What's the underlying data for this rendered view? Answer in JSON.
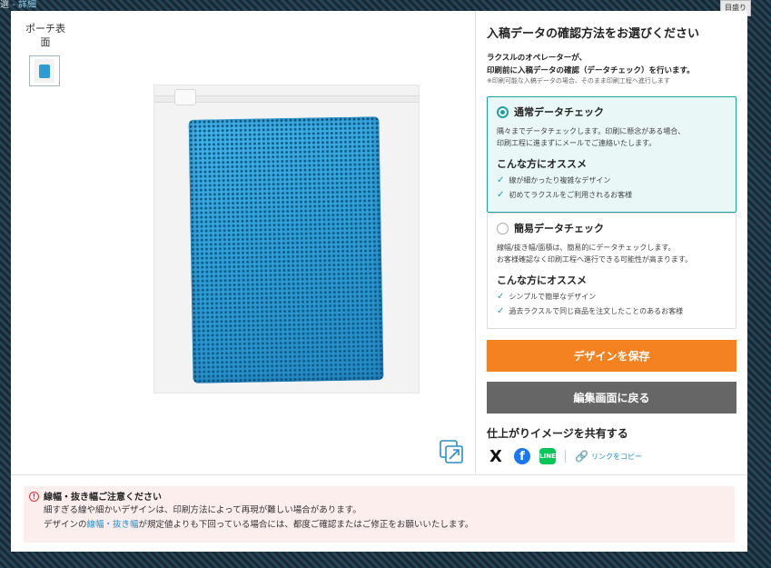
{
  "background": {
    "top_left_text": "選 ",
    "top_left_link": "- 詳細",
    "top_right_button": "目盛り"
  },
  "preview": {
    "thumbnail_label": "ポーチ表面",
    "product": "ポーチに入った青いメッシュタオル"
  },
  "panel": {
    "title": "入稿データの確認方法をお選びください",
    "desc_line1": "ラクスルのオペレーターが、",
    "desc_line2": "印刷前に入稿データの確認（データチェック）を行います。",
    "note": "※印刷可能な入稿データの場合、そのまま印刷工程へ進行します",
    "options": [
      {
        "title": "通常データチェック",
        "selected": true,
        "text1": "隅々までデータチェックします。印刷に懸念がある場合、",
        "text2": "印刷工程に進まずにメールでご連絡いたします。",
        "recommend_title": "こんな方にオススメ",
        "checks": [
          "線が細かったり複雑なデザイン",
          "初めてラクスルをご利用されるお客様"
        ]
      },
      {
        "title": "簡易データチェック",
        "selected": false,
        "text1": "線幅/抜き幅/面積は、簡易的にデータチェックします。",
        "text2": "お客様確認なく印刷工程へ進行できる可能性が高まります。",
        "recommend_title": "こんな方にオススメ",
        "checks": [
          "シンプルで簡単なデザイン",
          "過去ラクスルで同じ商品を注文したことのあるお客様"
        ]
      }
    ],
    "save_button": "デザインを保存",
    "back_button": "編集画面に戻る",
    "share_title": "仕上がりイメージを共有する",
    "share": {
      "x": "X",
      "facebook": "f",
      "line": "LINE",
      "copy_link": "リンクをコピー"
    }
  },
  "notice": {
    "title": "線幅・抜き幅ご注意ください",
    "line1": "細すぎる線や細かいデザインは、印刷方法によって再現が難しい場合があります。",
    "line2_pre": "デザインの",
    "line2_link": "線幅・抜き幅",
    "line2_post": "が規定値よりも下回っている場合には、都度ご確認またはご修正をお願いいたします。"
  },
  "colors": {
    "accent_teal": "#1aa3a0",
    "save_orange": "#f58220",
    "back_gray": "#666666",
    "notice_bg": "#fdeeee",
    "warn_red": "#d8323c"
  }
}
